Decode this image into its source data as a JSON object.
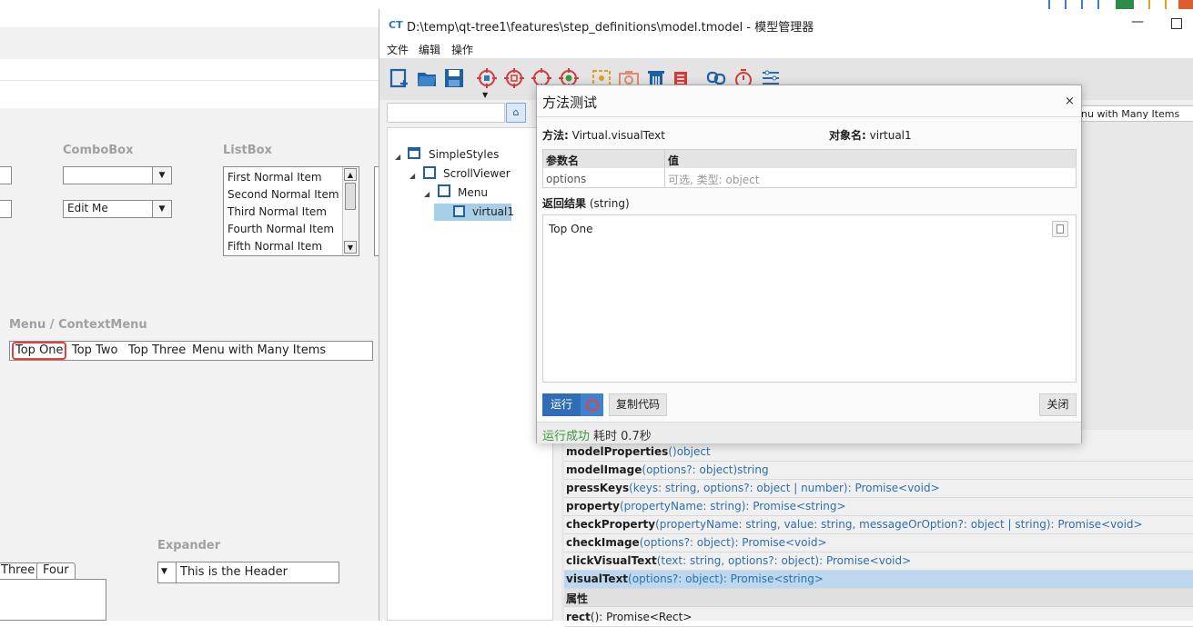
{
  "background_app": {
    "combobox_title": "ComboBox",
    "listbox_title": "ListBox",
    "combo_editable_value": "Edit Me",
    "listbox_items": [
      "First Normal Item",
      "Second Normal Item",
      "Third Normal Item",
      "Fourth Normal Item",
      "Fifth Normal Item"
    ],
    "menu_title": "Menu / ContextMenu",
    "menu_items": [
      "Top One",
      "Top Two",
      "Top Three",
      "Menu with Many Items"
    ],
    "tabs": [
      "Three",
      "Four"
    ],
    "expander_title": "Expander",
    "expander_header": "This is the Header"
  },
  "model_manager": {
    "title_icon": "CT",
    "title": "D:\\temp\\qt-tree1\\features\\step_definitions\\model.tmodel - 模型管理器",
    "menu": [
      "文件",
      "编辑",
      "操作"
    ],
    "tree": [
      {
        "label": "SimpleStyles",
        "depth": 0,
        "icon": "window-icon"
      },
      {
        "label": "ScrollViewer",
        "depth": 1,
        "icon": "scrollviewer-icon"
      },
      {
        "label": "Menu",
        "depth": 2,
        "icon": "menu-icon"
      },
      {
        "label": "virtual1",
        "depth": 3,
        "icon": "virtual-icon",
        "selected": true
      }
    ],
    "right_header_text": "nu with Many Items",
    "methods": [
      {
        "name": "modelProperties",
        "sig": "()object"
      },
      {
        "name": "modelImage",
        "sig": "(options?: object)string"
      },
      {
        "name": "pressKeys",
        "sig": "(keys: string, options?: object | number): Promise<void>"
      },
      {
        "name": "property",
        "sig": "(propertyName: string): Promise<string>"
      },
      {
        "name": "checkProperty",
        "sig": "(propertyName: string, value: string, messageOrOption?: object | string): Promise<void>"
      },
      {
        "name": "checkImage",
        "sig": "(options?: object): Promise<void>"
      },
      {
        "name": "clickVisualText",
        "sig": "(text: string, options?: object): Promise<void>"
      },
      {
        "name": "visualText",
        "sig": "(options?: object): Promise<string>",
        "selected": true
      }
    ],
    "props_header": "属性",
    "props_first": {
      "name": "rect",
      "sig": "(): Promise<Rect>"
    }
  },
  "dialog": {
    "title": "方法测试",
    "close_glyph": "×",
    "method_label": "方法:",
    "method_value": "Virtual.visualText",
    "object_label": "对象名:",
    "object_value": "virtual1",
    "param_header_name": "参数名",
    "param_header_value": "值",
    "param_name": "options",
    "param_placeholder": "可选, 类型: object",
    "result_label": "返回结果",
    "result_type": "(string)",
    "result_value": "Top One",
    "run_label": "运行",
    "copy_code_label": "复制代码",
    "close_label": "关闭",
    "status_success": "运行成功",
    "status_time": "耗时 0.7秒",
    "colors": {
      "run": "#2f6eb5",
      "success": "#3a9a3a",
      "selected_row": "#bdd8ee",
      "stop": "#e14444"
    }
  }
}
